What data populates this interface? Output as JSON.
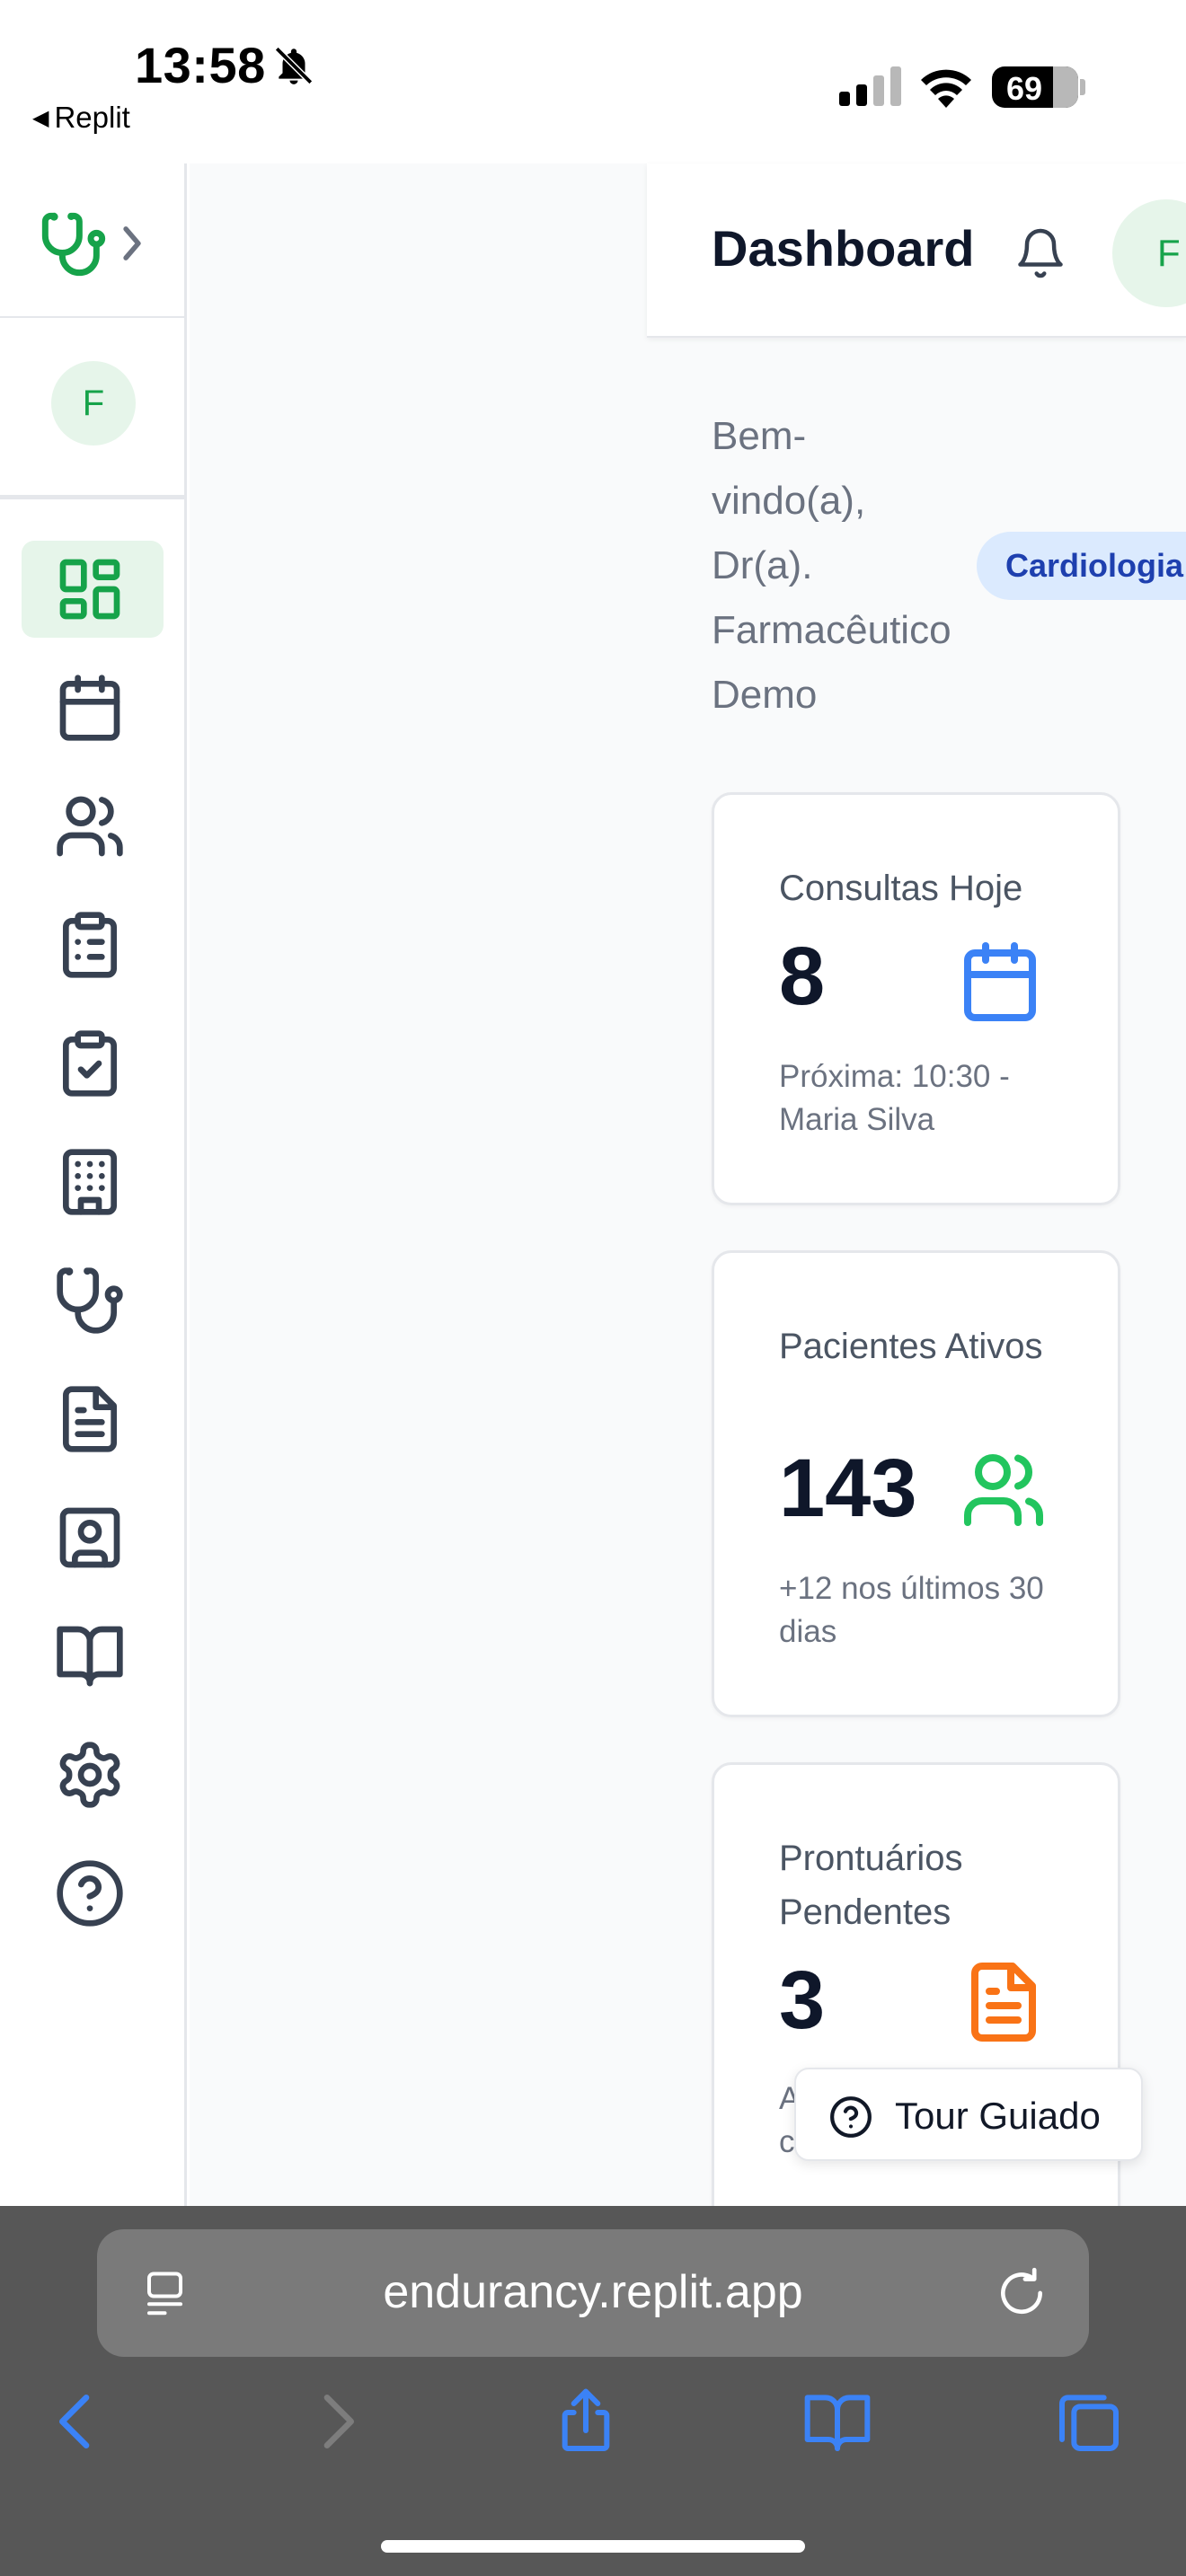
{
  "status_bar": {
    "time": "13:58",
    "back_app": "Replit",
    "battery": "69"
  },
  "sidebar": {
    "user_initial": "F",
    "nav": [
      {
        "name": "dashboard",
        "icon": "layout-dashboard-icon",
        "active": true
      },
      {
        "name": "agenda",
        "icon": "calendar-icon",
        "active": false
      },
      {
        "name": "pacientes",
        "icon": "users-icon",
        "active": false
      },
      {
        "name": "prontuarios",
        "icon": "clipboard-list-icon",
        "active": false
      },
      {
        "name": "tarefas",
        "icon": "clipboard-check-icon",
        "active": false
      },
      {
        "name": "clinicas",
        "icon": "building-icon",
        "active": false
      },
      {
        "name": "consultas",
        "icon": "stethoscope-icon",
        "active": false
      },
      {
        "name": "documentos",
        "icon": "file-text-icon",
        "active": false
      },
      {
        "name": "contatos",
        "icon": "contact-icon",
        "active": false
      },
      {
        "name": "biblioteca",
        "icon": "book-open-icon",
        "active": false
      },
      {
        "name": "configuracoes",
        "icon": "settings-icon",
        "active": false
      },
      {
        "name": "ajuda",
        "icon": "help-circle-icon",
        "active": false
      }
    ]
  },
  "header": {
    "title": "Dashboard",
    "user_initial": "F"
  },
  "welcome": {
    "lines": [
      "Bem-",
      "vindo(a),",
      "Dr(a).",
      "Farmacêutico",
      "Demo"
    ],
    "specialty_badge": "Cardiologia"
  },
  "cards": [
    {
      "title": "Consultas Hoje",
      "value": "8",
      "sub": "Próxima: 10:30 - Maria Silva",
      "icon": "calendar-icon",
      "color": "#3b82f6"
    },
    {
      "title": "Pacientes Ativos",
      "value": "143",
      "sub": "+12 nos últimos 30 dias",
      "icon": "users-icon",
      "color": "#22c55e"
    },
    {
      "title": "Prontuários Pendentes",
      "value": "3",
      "sub": "A c",
      "icon": "file-text-icon",
      "color": "#f97316"
    }
  ],
  "tour_button": {
    "label": "Tour Guiado"
  },
  "browser": {
    "url": "endurancy.replit.app"
  },
  "colors": {
    "brand_green": "#16a34a",
    "nav_icon": "#374151",
    "safari_blue": "#3b82f6"
  }
}
